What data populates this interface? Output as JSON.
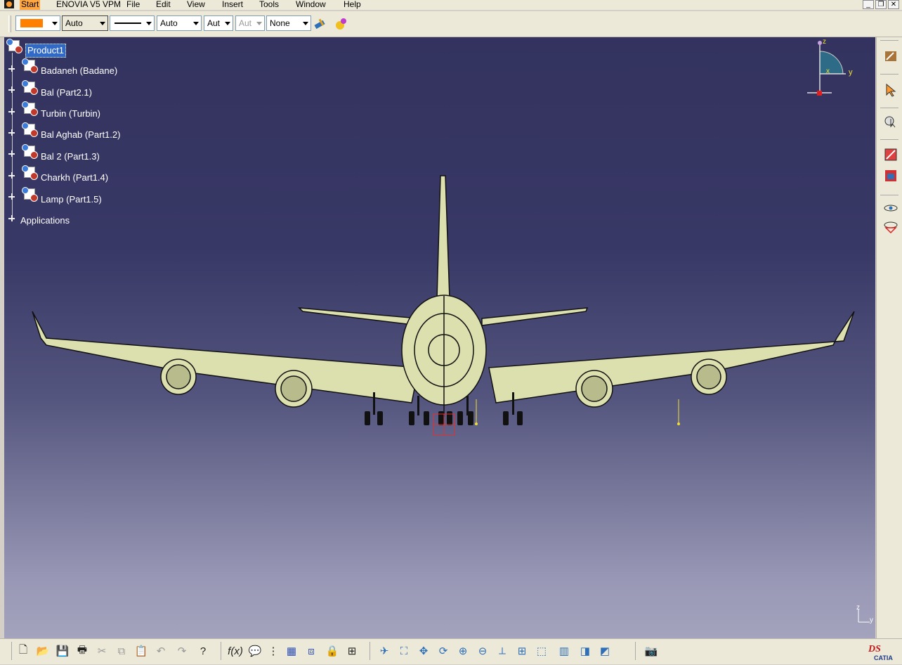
{
  "menubar": {
    "start": "Start",
    "items": [
      "ENOVIA V5 VPM",
      "File",
      "Edit",
      "View",
      "Insert",
      "Tools",
      "Window",
      "Help"
    ]
  },
  "graphic_properties": {
    "fill_color": "#ff8000",
    "transparency": "Auto",
    "linetype": "",
    "thickness": "Auto",
    "linetype_small": "Aut",
    "point_symbol": "Aut",
    "layer": "None"
  },
  "tree": {
    "root": "Product1",
    "children": [
      "Badaneh (Badane)",
      "Bal (Part2.1)",
      "Turbin (Turbin)",
      "Bal Aghab (Part1.2)",
      "Bal 2 (Part1.3)",
      "Charkh (Part1.4)",
      "Lamp (Part1.5)"
    ],
    "applications": "Applications"
  },
  "compass": {
    "z": "z",
    "x": "x",
    "y": "y"
  },
  "axis_indicator": {
    "z": "z",
    "y": "y"
  },
  "colors": {
    "viewport_top": "#34335f",
    "viewport_bottom": "#a4a3bd",
    "airplane": "#dcdfae",
    "selected": "#3169c6"
  },
  "right_toolbar": [
    "sketcher-icon",
    "select-arrow-icon",
    "snap-icon",
    "render-icon",
    "shading-icon",
    "show-eye-icon",
    "hide-eye-icon"
  ],
  "bottom_toolbar": [
    "new-icon",
    "open-icon",
    "save-icon",
    "print-icon",
    "cut-icon",
    "copy-icon",
    "paste-icon",
    "undo-icon",
    "redo-icon",
    "whats-this-icon",
    "formula-icon",
    "comment-icon",
    "knowledge-icon",
    "table-icon",
    "graph-icon",
    "lock-icon",
    "measure-icon",
    "fly-icon",
    "fit-all-icon",
    "pan-icon",
    "rotate-icon",
    "zoom-in-icon",
    "zoom-out-icon",
    "normal-view-icon",
    "multi-view-icon",
    "iso-view-icon",
    "shading-mode-icon",
    "hide-show-icon",
    "swap-icon",
    "capture-icon"
  ],
  "logo": {
    "brand": "CATIA"
  }
}
